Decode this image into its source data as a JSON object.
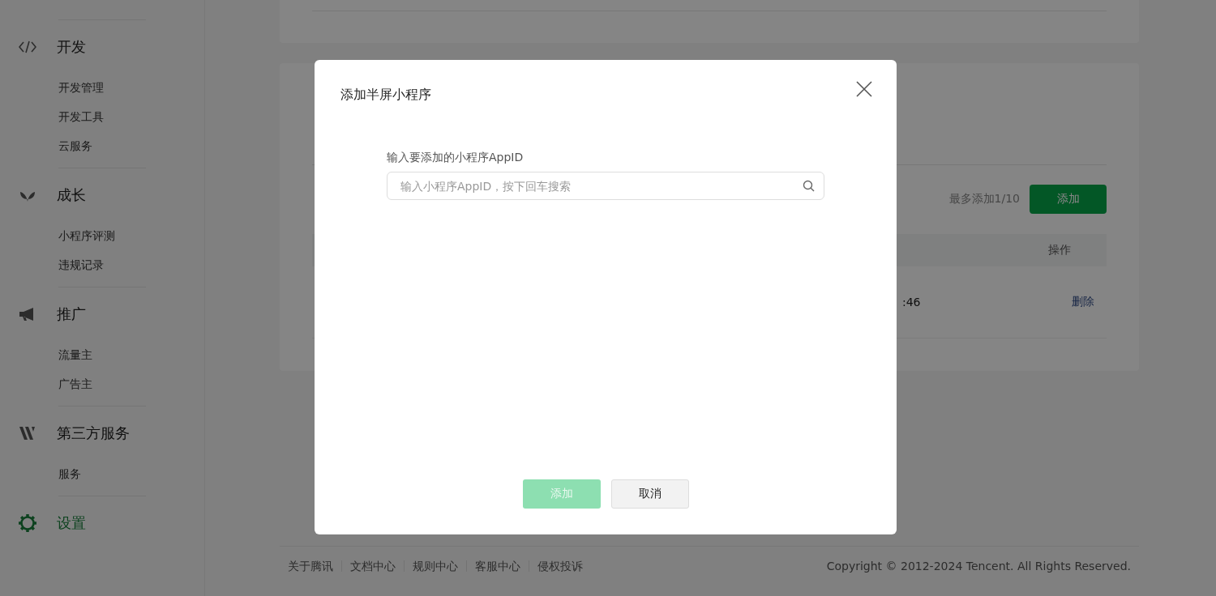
{
  "sidebar": {
    "groups": [
      {
        "label": "开发",
        "selected": false,
        "items": [
          "开发管理",
          "开发工具",
          "云服务"
        ]
      },
      {
        "label": "成长",
        "selected": false,
        "items": [
          "小程序评测",
          "违规记录"
        ]
      },
      {
        "label": "推广",
        "selected": false,
        "items": [
          "流量主",
          "广告主"
        ]
      },
      {
        "label": "第三方服务",
        "selected": false,
        "items": [
          "服务"
        ]
      },
      {
        "label": "设置",
        "selected": true
      }
    ]
  },
  "panel": {
    "limit_note": "最多添加1/10",
    "add_button": "添加",
    "table": {
      "columns": [
        "操作"
      ],
      "rows": [
        {
          "time": ":46",
          "action": "删除"
        }
      ]
    }
  },
  "footer": {
    "links": [
      "关于腾讯",
      "文档中心",
      "规则中心",
      "客服中心",
      "侵权投诉"
    ],
    "copyright": "Copyright © 2012-2024 Tencent. All Rights Reserved."
  },
  "dialog": {
    "title": "添加半屏小程序",
    "field_label": "输入要添加的小程序AppID",
    "search": {
      "placeholder": "输入小程序AppID，按下回车搜索"
    },
    "buttons": [
      {
        "label": "添加",
        "kind": "primary",
        "disabled": true
      },
      {
        "label": "取消",
        "kind": "default",
        "disabled": false
      }
    ]
  }
}
